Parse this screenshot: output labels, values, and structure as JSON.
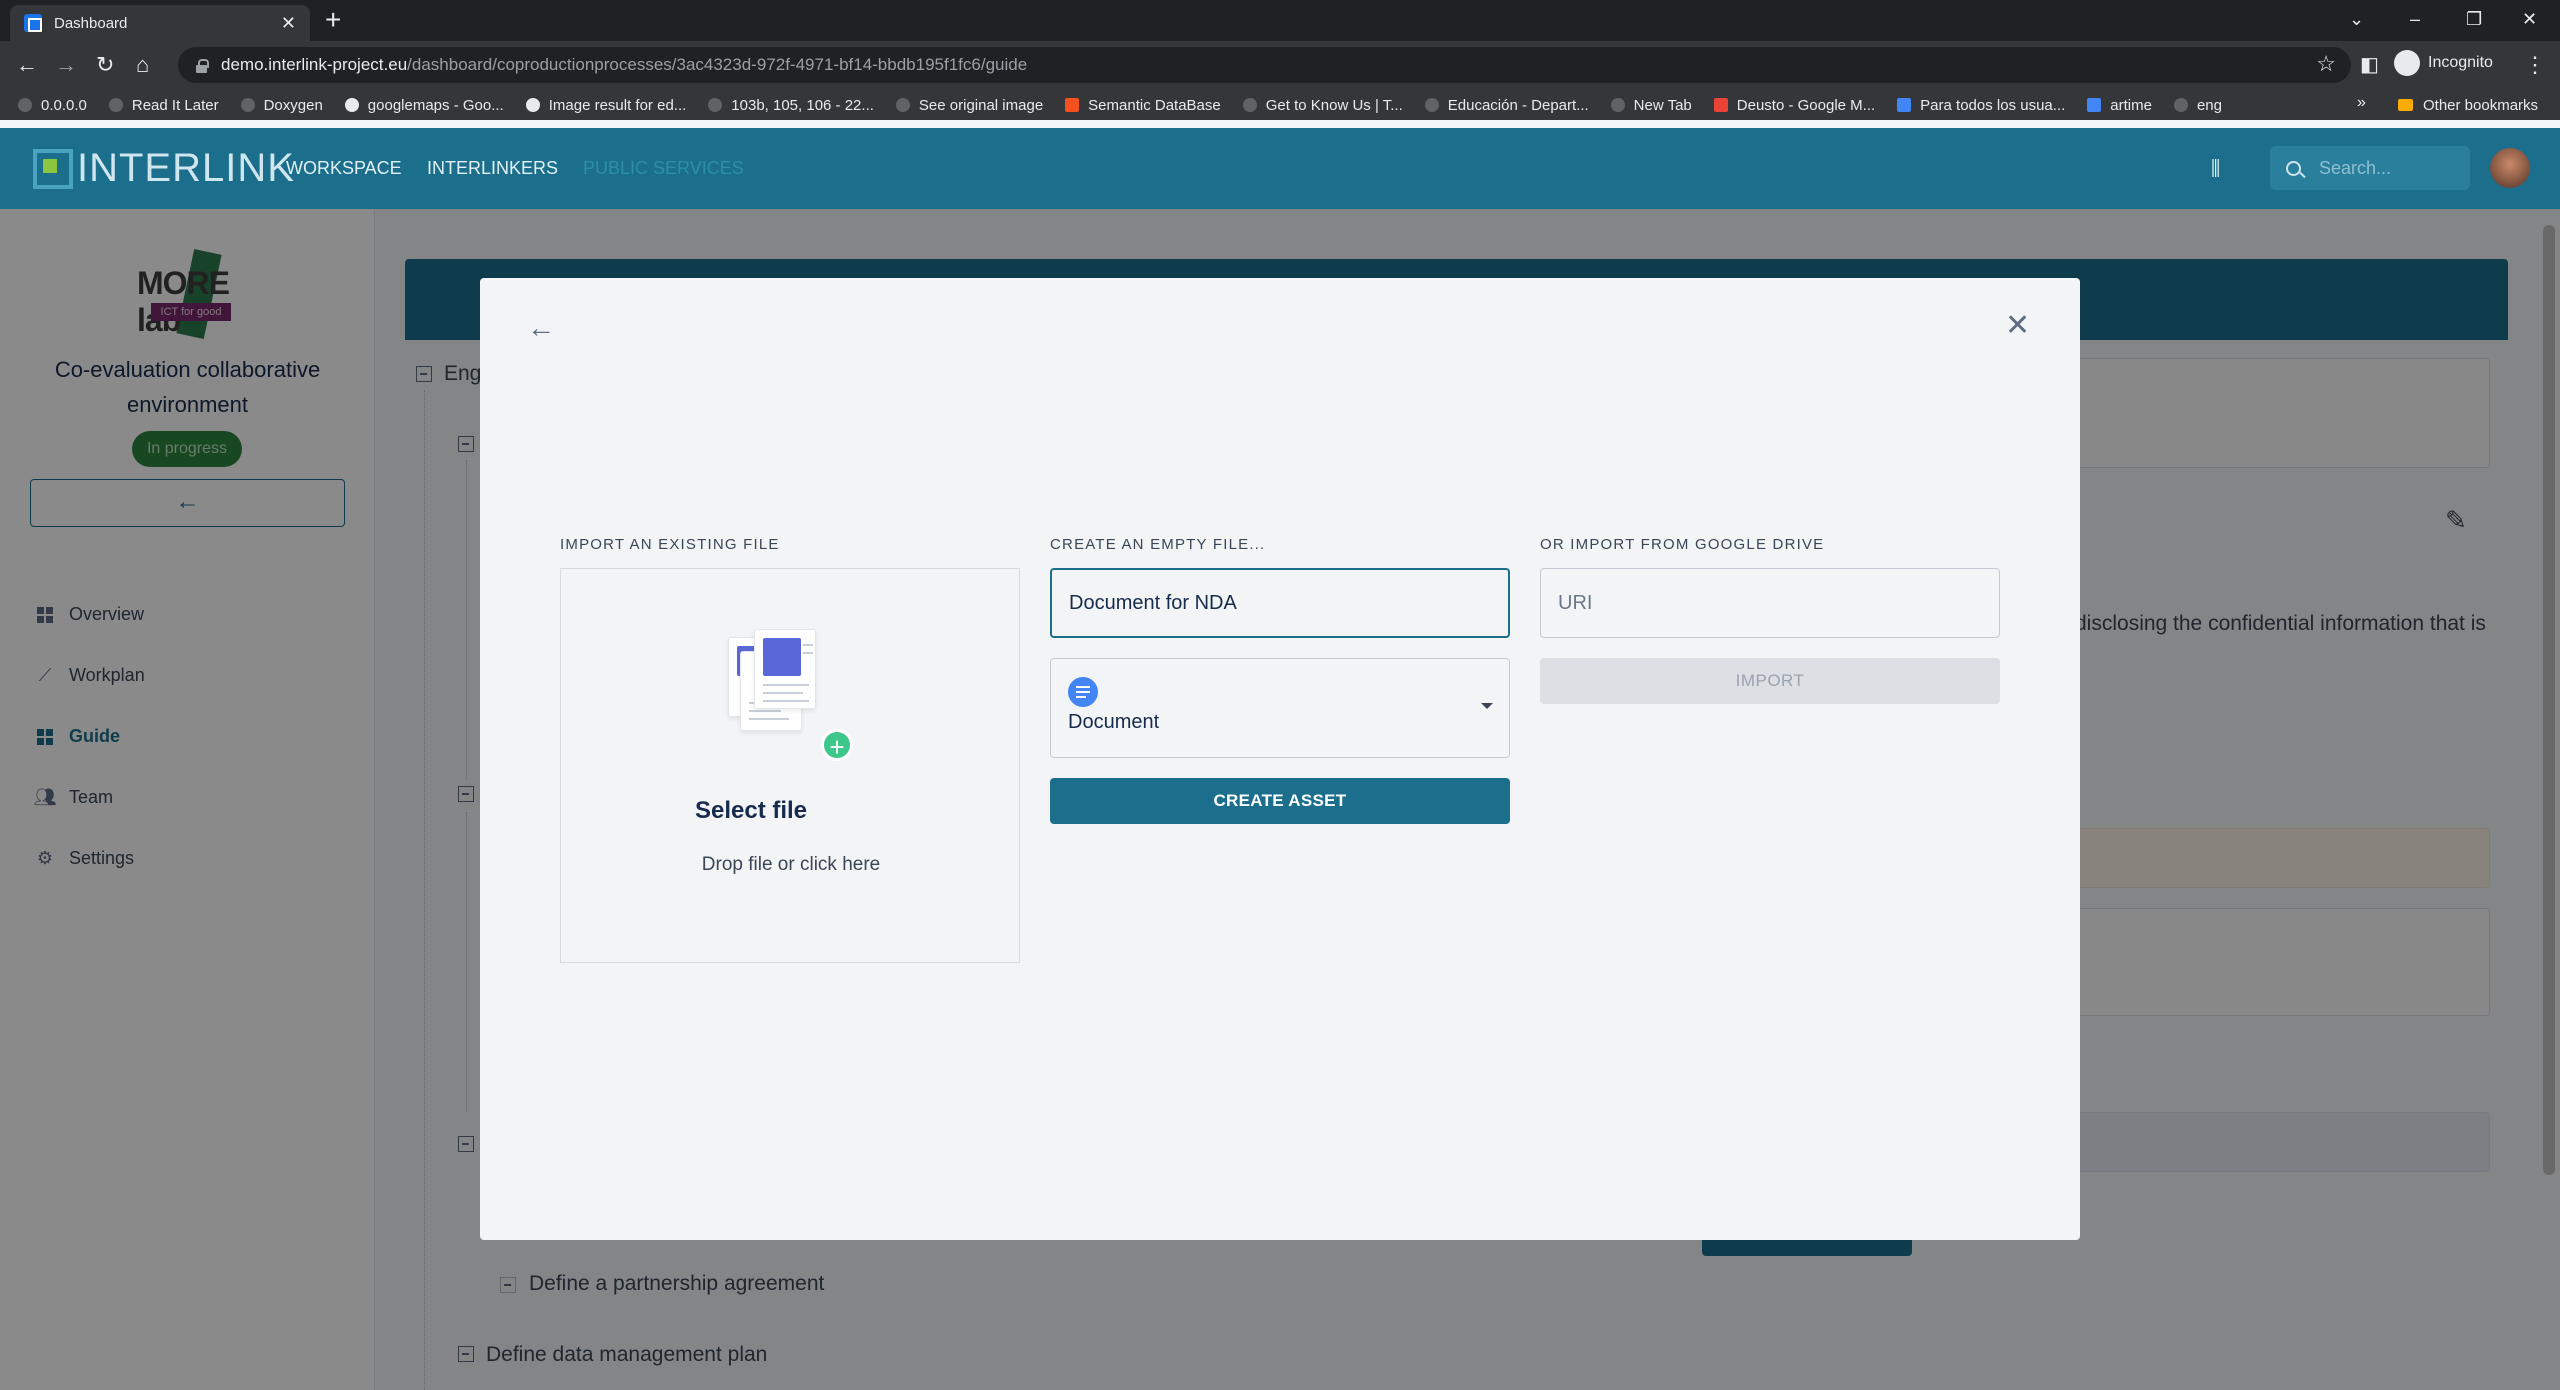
{
  "browser": {
    "tab_title": "Dashboard",
    "url_host": "demo.interlink-project.eu",
    "url_path": "/dashboard/coproductionprocesses/3ac4323d-972f-4971-bf14-bbdb195f1fc6/guide",
    "profile_label": "Incognito",
    "bookmarks": [
      {
        "label": "0.0.0.0",
        "icon": "globe-icon"
      },
      {
        "label": "Read It Later",
        "icon": "globe-icon"
      },
      {
        "label": "Doxygen",
        "icon": "globe-icon"
      },
      {
        "label": "googlemaps - Goo...",
        "icon": "google-icon"
      },
      {
        "label": "Image result for ed...",
        "icon": "google-icon"
      },
      {
        "label": "103b, 105, 106 - 22...",
        "icon": "globe-icon"
      },
      {
        "label": "See original image",
        "icon": "globe-icon"
      },
      {
        "label": "Semantic DataBase",
        "icon": "blogger-icon"
      },
      {
        "label": "Get to Know Us | T...",
        "icon": "globe-icon"
      },
      {
        "label": "Educación - Depart...",
        "icon": "globe-icon"
      },
      {
        "label": "New Tab",
        "icon": "globe-icon"
      },
      {
        "label": "Deusto - Google M...",
        "icon": "maps-icon"
      },
      {
        "label": "Para todos los usua...",
        "icon": "doc-icon"
      },
      {
        "label": "artime",
        "icon": "doc-icon"
      },
      {
        "label": "eng",
        "icon": "globe-icon"
      }
    ],
    "bookmarks_more": "»",
    "other_bookmarks": "Other bookmarks"
  },
  "app": {
    "logo_text": "INTERLINK",
    "nav": [
      "WORKSPACE",
      "INTERLINKERS",
      "PUBLIC SERVICES"
    ],
    "search_placeholder": "Search..."
  },
  "sidebar": {
    "logo_text": "MORE lab",
    "logo_subtext": "ICT for good",
    "project_title": "Co-evaluation collaborative environment",
    "status": "In progress",
    "items": [
      {
        "label": "Overview",
        "icon": "dashboard-icon"
      },
      {
        "label": "Workplan",
        "icon": "timeline-icon"
      },
      {
        "label": "Guide",
        "icon": "guide-icon",
        "active": true
      },
      {
        "label": "Team",
        "icon": "people-icon"
      },
      {
        "label": "Settings",
        "icon": "gear-icon"
      }
    ]
  },
  "background": {
    "section_truncated": "Enga",
    "paragraph_fragment": "disclosing the confidential information that is",
    "task_partnership": "Define a partnership agreement",
    "task_data_plan": "Define data management plan"
  },
  "modal": {
    "import_label": "IMPORT AN EXISTING FILE",
    "select_file_title": "Select file",
    "select_file_sub": "Drop file or click here",
    "create_label": "CREATE AN EMPTY FILE...",
    "name_value": "Document for NDA",
    "type_value": "Document",
    "create_button": "CREATE ASSET",
    "drive_label": "OR IMPORT FROM GOOGLE DRIVE",
    "uri_placeholder": "URI",
    "import_button": "IMPORT"
  },
  "colors": {
    "brand": "#1b6f8c",
    "status_green": "#2e8540",
    "doc_blue": "#4285f4"
  }
}
